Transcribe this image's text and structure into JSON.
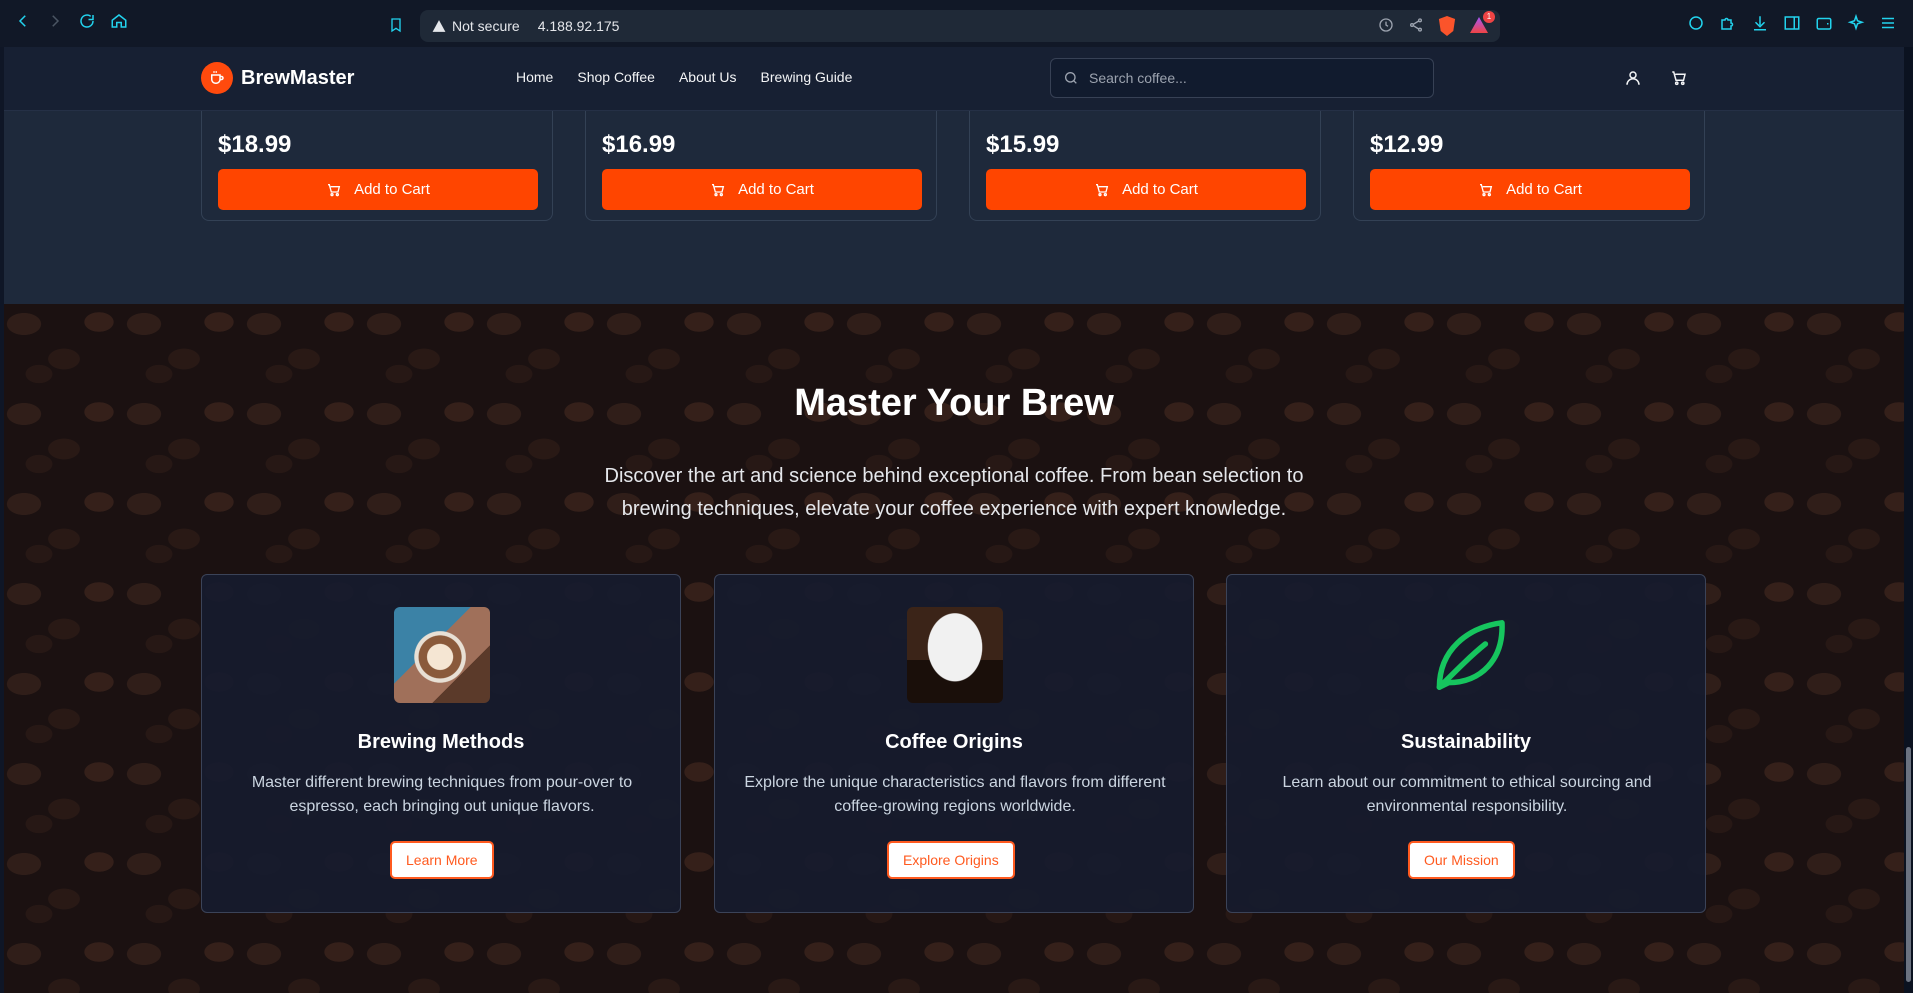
{
  "browser": {
    "security_label": "Not secure",
    "url": "4.188.92.175",
    "rewards_badge": "1"
  },
  "header": {
    "brand": "BrewMaster",
    "nav": [
      "Home",
      "Shop Coffee",
      "About Us",
      "Brewing Guide"
    ],
    "search_placeholder": "Search coffee..."
  },
  "products": [
    {
      "price": "$18.99",
      "button": "Add to Cart"
    },
    {
      "price": "$16.99",
      "button": "Add to Cart"
    },
    {
      "price": "$15.99",
      "button": "Add to Cart"
    },
    {
      "price": "$12.99",
      "button": "Add to Cart"
    }
  ],
  "brew_section": {
    "title": "Master Your Brew",
    "intro": "Discover the art and science behind exceptional coffee. From bean selection to brewing techniques, elevate your coffee experience with expert knowledge.",
    "cards": [
      {
        "title": "Brewing Methods",
        "text": "Master different brewing techniques from pour-over to espresso, each bringing out unique flavors.",
        "cta": "Learn More",
        "icon": "latte-art-image"
      },
      {
        "title": "Coffee Origins",
        "text": "Explore the unique characteristics and flavors from different coffee-growing regions worldwide.",
        "cta": "Explore Origins",
        "icon": "coffee-cup-image"
      },
      {
        "title": "Sustainability",
        "text": "Learn about our commitment to ethical sourcing and environmental responsibility.",
        "cta": "Our Mission",
        "icon": "leaf-icon"
      }
    ]
  },
  "colors": {
    "accent": "#ff4500",
    "header_bg": "#172033",
    "leaf": "#16c55e"
  }
}
